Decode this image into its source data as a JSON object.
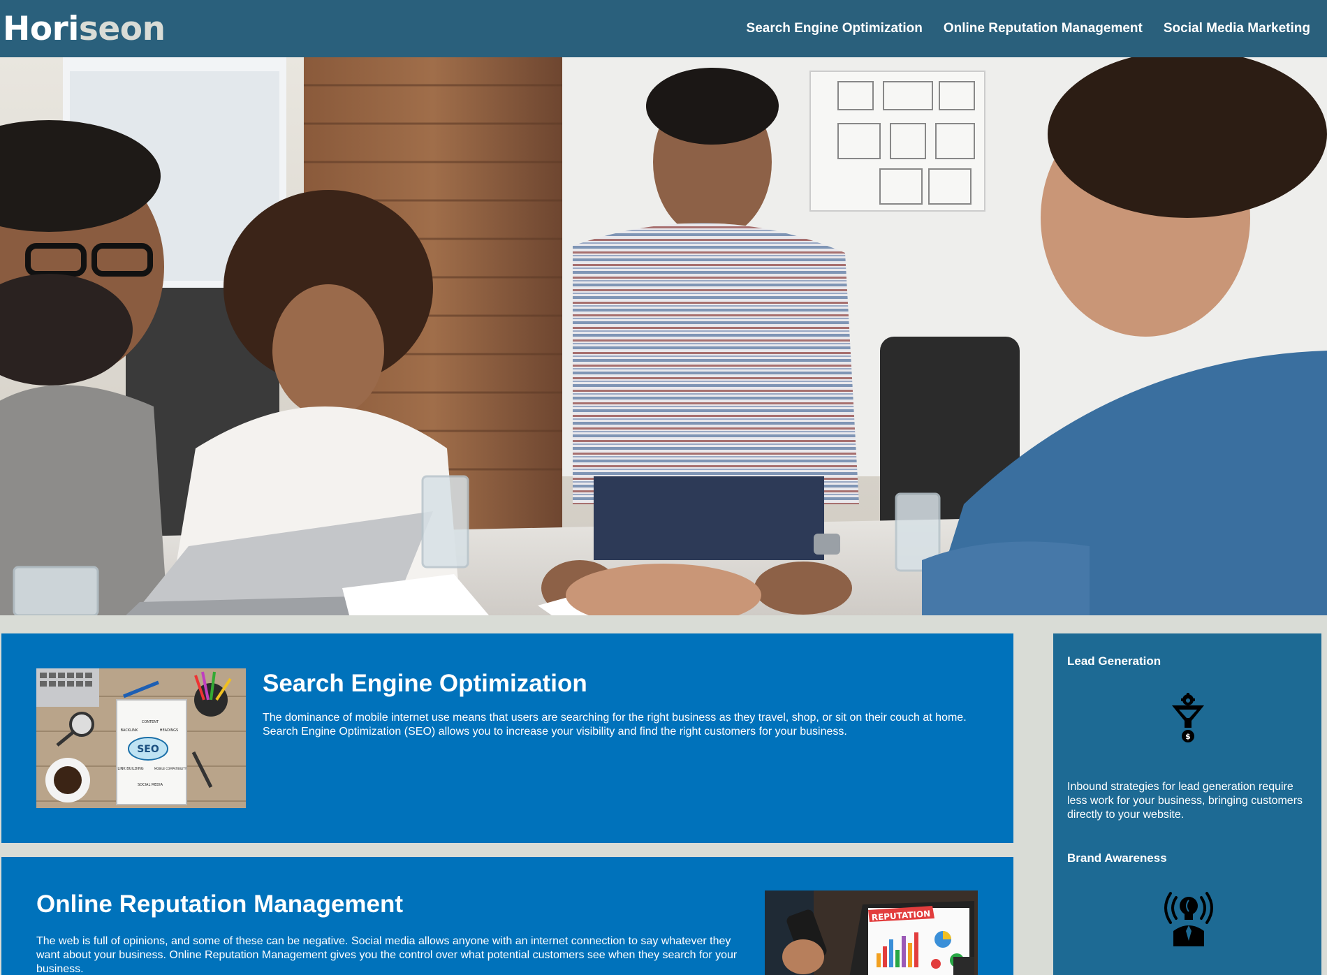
{
  "header": {
    "logo_main": "Hori",
    "logo_accent": "seon",
    "nav": [
      "Search Engine Optimization",
      "Online Reputation Management",
      "Social Media Marketing"
    ]
  },
  "hero": {
    "image": "team-meeting-photo"
  },
  "sections": {
    "seo": {
      "title": "Search Engine Optimization",
      "text": "The dominance of mobile internet use means that users are searching for the right business as they travel, shop, or sit on their couch at home. Search Engine Optimization (SEO) allows you to increase your visibility and find the right customers for your business.",
      "image_words": [
        "CONTENT",
        "BACKLINK",
        "HEADINGS",
        "SEO",
        "LINK BUILDING",
        "MOBILE COMPATIBILITY",
        "SOCIAL MEDIA"
      ]
    },
    "orm": {
      "title": "Online Reputation Management",
      "text": "The web is full of opinions, and some of these can be negative. Social media allows anyone with an internet connection to say whatever they want about your business. Online Reputation Management gives you the control over what potential customers see when they search for your business.",
      "image_word": "REPUTATION"
    }
  },
  "aside": {
    "lead": {
      "title": "Lead Generation",
      "icon": "funnel-gear-dollar-icon",
      "text": "Inbound strategies for lead generation require less work for your business, bringing customers directly to your website."
    },
    "brand": {
      "title": "Brand Awareness",
      "icon": "lightbulb-person-icon"
    }
  },
  "colors": {
    "header": "#2a607c",
    "content": "#0072bb",
    "aside": "#1d6a94",
    "page": "#d9dcd6"
  }
}
